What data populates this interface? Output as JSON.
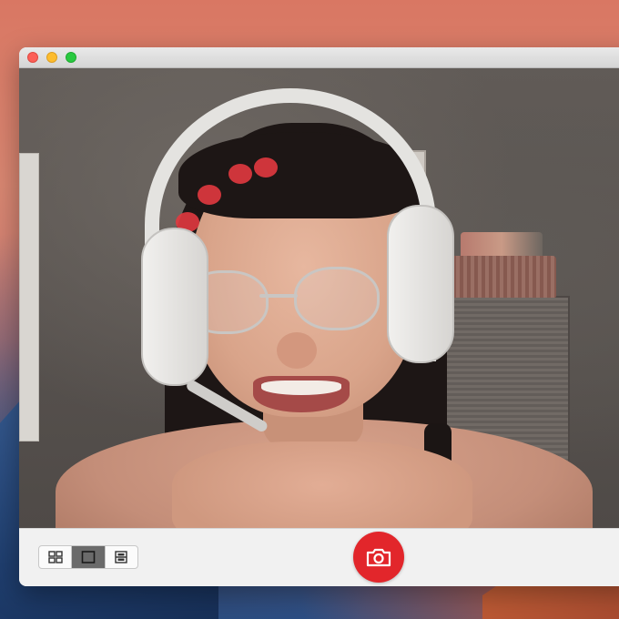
{
  "window": {
    "controls": [
      "close",
      "minimize",
      "zoom"
    ]
  },
  "toolbar": {
    "view_modes": [
      {
        "name": "grid-view",
        "icon": "grid-icon",
        "active": false
      },
      {
        "name": "single-view",
        "icon": "square-icon",
        "active": true
      },
      {
        "name": "filmstrip-view",
        "icon": "filmstrip-icon",
        "active": false
      }
    ],
    "shutter": {
      "icon": "camera-icon"
    }
  },
  "colors": {
    "close": "#fc5f57",
    "minimize": "#fdbc2e",
    "zoom": "#29c940",
    "shutter": "#e2262b",
    "active_toggle": "#6b6b6b"
  }
}
